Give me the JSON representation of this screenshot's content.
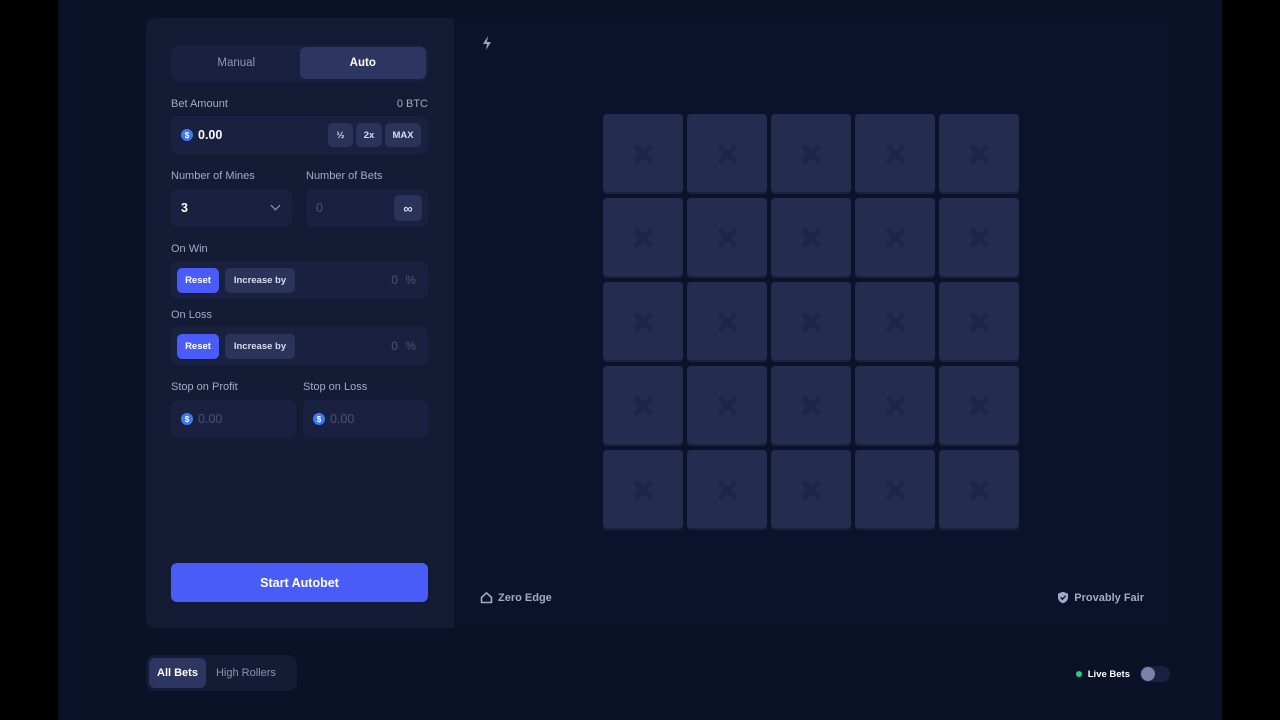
{
  "modes": {
    "manual": "Manual",
    "auto": "Auto",
    "active": "auto"
  },
  "bet": {
    "label": "Bet Amount",
    "btc_value": "0 BTC",
    "currency_symbol": "$",
    "amount": "0.00",
    "half_label": "½",
    "double_label": "2x",
    "max_label": "MAX"
  },
  "mines": {
    "label": "Number of Mines",
    "value": "3"
  },
  "bets_count": {
    "label": "Number of Bets",
    "placeholder": "0",
    "infinite_label": "∞"
  },
  "on_win": {
    "label": "On Win",
    "reset_label": "Reset",
    "increase_label": "Increase by",
    "value": "0",
    "unit": "%"
  },
  "on_loss": {
    "label": "On Loss",
    "reset_label": "Reset",
    "increase_label": "Increase by",
    "value": "0",
    "unit": "%"
  },
  "stop_profit": {
    "label": "Stop on Profit",
    "currency_symbol": "$",
    "placeholder": "0.00"
  },
  "stop_loss": {
    "label": "Stop on Loss",
    "currency_symbol": "$",
    "placeholder": "0.00"
  },
  "start_label": "Start Autobet",
  "board": {
    "rows": 5,
    "cols": 5,
    "tile_icon": "x-icon"
  },
  "footer": {
    "zero_edge": "Zero Edge",
    "provably_fair": "Provably Fair"
  },
  "bottom": {
    "all_bets": "All Bets",
    "high_rollers": "High Rollers",
    "live_bets": "Live Bets",
    "live_bets_enabled": false
  },
  "colors": {
    "accent": "#4a5cf7",
    "tile": "#242c4f",
    "live": "#1fcf8c",
    "coin": "#3e7bf2"
  }
}
